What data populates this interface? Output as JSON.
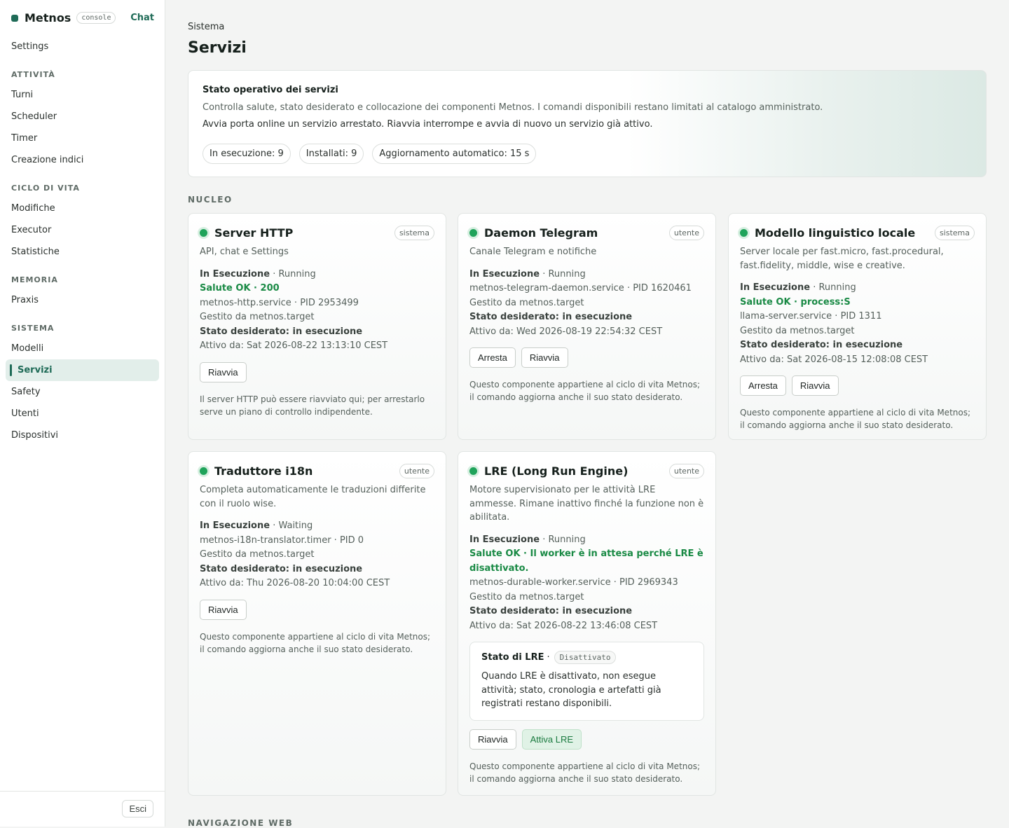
{
  "app": {
    "name": "Metnos",
    "badge": "console",
    "chat_link": "Chat"
  },
  "sidebar": {
    "top_item": "Settings",
    "groups": [
      {
        "label": "ATTIVITÀ",
        "items": [
          "Turni",
          "Scheduler",
          "Timer",
          "Creazione indici"
        ]
      },
      {
        "label": "CICLO DI VITA",
        "items": [
          "Modifiche",
          "Executor",
          "Statistiche"
        ]
      },
      {
        "label": "MEMORIA",
        "items": [
          "Praxis"
        ]
      },
      {
        "label": "SISTEMA",
        "items": [
          "Modelli",
          "Servizi",
          "Safety",
          "Utenti",
          "Dispositivi"
        ]
      }
    ],
    "active_item": "Servizi",
    "logout_label": "Esci"
  },
  "page": {
    "breadcrumb": "Sistema",
    "title": "Servizi"
  },
  "overview": {
    "title": "Stato operativo dei servizi",
    "description": "Controlla salute, stato desiderato e collocazione dei componenti Metnos. I comandi disponibili restano limitati al catalogo amministrato.",
    "help": "Avvia porta online un servizio arrestato. Riavvia interrompe e avvia di nuovo un servizio già attivo.",
    "pills": [
      "In esecuzione: 9",
      "Installati: 9",
      "Aggiornamento automatico: 15 s"
    ]
  },
  "sections": [
    {
      "title": "NUCLEO"
    },
    {
      "title": "NAVIGAZIONE WEB"
    }
  ],
  "services": [
    {
      "name": "Server HTTP",
      "scope": "sistema",
      "description": "API, chat e Settings",
      "state": "In Esecuzione",
      "substate": "· Running",
      "health": "Salute OK · 200",
      "unit": "metnos-http.service · PID 2953499",
      "managed": "Gestito da metnos.target",
      "desired": "Stato desiderato: in esecuzione",
      "since": "Attivo da: Sat 2026-08-22 13:13:10 CEST",
      "actions": [
        "Riavvia"
      ],
      "note": "Il server HTTP può essere riavviato qui; per arrestarlo serve un piano di controllo indipendente."
    },
    {
      "name": "Daemon Telegram",
      "scope": "utente",
      "description": "Canale Telegram e notifiche",
      "state": "In Esecuzione",
      "substate": "· Running",
      "health": "",
      "unit": "metnos-telegram-daemon.service · PID 1620461",
      "managed": "Gestito da metnos.target",
      "desired": "Stato desiderato: in esecuzione",
      "since": "Attivo da: Wed 2026-08-19 22:54:32 CEST",
      "actions": [
        "Arresta",
        "Riavvia"
      ],
      "note": "Questo componente appartiene al ciclo di vita Metnos; il comando aggiorna anche il suo stato desiderato."
    },
    {
      "name": "Modello linguistico locale",
      "scope": "sistema",
      "description": "Server locale per fast.micro, fast.procedural, fast.fidelity, middle, wise e creative.",
      "state": "In Esecuzione",
      "substate": "· Running",
      "health": "Salute OK · process:S",
      "unit": "llama-server.service · PID 1311",
      "managed": "Gestito da metnos.target",
      "desired": "Stato desiderato: in esecuzione",
      "since": "Attivo da: Sat 2026-08-15 12:08:08 CEST",
      "actions": [
        "Arresta",
        "Riavvia"
      ],
      "note": "Questo componente appartiene al ciclo di vita Metnos; il comando aggiorna anche il suo stato desiderato."
    },
    {
      "name": "Traduttore i18n",
      "scope": "utente",
      "description": "Completa automaticamente le traduzioni differite con il ruolo wise.",
      "state": "In Esecuzione",
      "substate": "· Waiting",
      "health": "",
      "unit": "metnos-i18n-translator.timer · PID 0",
      "managed": "Gestito da metnos.target",
      "desired": "Stato desiderato: in esecuzione",
      "since": "Attivo da: Thu 2026-08-20 10:04:00 CEST",
      "actions": [
        "Riavvia"
      ],
      "note": "Questo componente appartiene al ciclo di vita Metnos; il comando aggiorna anche il suo stato desiderato."
    },
    {
      "name": "LRE (Long Run Engine)",
      "scope": "utente",
      "description": "Motore supervisionato per le attività LRE ammesse. Rimane inattivo finché la funzione non è abilitata.",
      "state": "In Esecuzione",
      "substate": "· Running",
      "health": "Salute OK · Il worker è in attesa perché LRE è disattivato.",
      "unit": "metnos-durable-worker.service · PID 2969343",
      "managed": "Gestito da metnos.target",
      "desired": "Stato desiderato: in esecuzione",
      "since": "Attivo da: Sat 2026-08-22 13:46:08 CEST",
      "lre": {
        "title": "Stato di LRE",
        "sep": "·",
        "badge": "Disattivato",
        "text": "Quando LRE è disattivato, non esegue attività; stato, cronologia e artefatti già registrati restano disponibili."
      },
      "actions": [
        "Riavvia",
        "Attiva LRE"
      ],
      "note": "Questo componente appartiene al ciclo di vita Metnos; il comando aggiorna anche il suo stato desiderato."
    }
  ],
  "colors": {
    "accent": "#1f6b57",
    "status_ok": "#1fa35a",
    "health_text": "#1a8a45"
  }
}
